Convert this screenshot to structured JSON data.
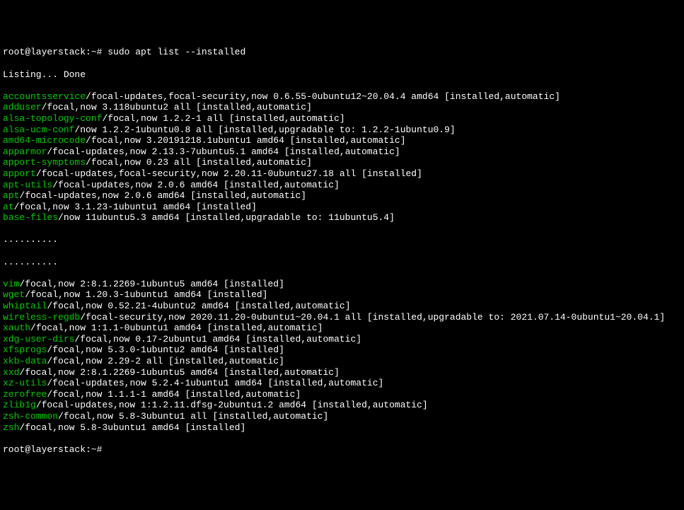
{
  "prompt1": {
    "user_host": "root@layerstack",
    "tilde": ":~",
    "hash": "# ",
    "command": "sudo apt list --installed"
  },
  "listing": "Listing... Done",
  "packages_top": [
    {
      "name": "accountsservice",
      "rest": "/focal-updates,focal-security,now 0.6.55-0ubuntu12~20.04.4 amd64 [installed,automatic]"
    },
    {
      "name": "adduser",
      "rest": "/focal,now 3.118ubuntu2 all [installed,automatic]"
    },
    {
      "name": "alsa-topology-conf",
      "rest": "/focal,now 1.2.2-1 all [installed,automatic]"
    },
    {
      "name": "alsa-ucm-conf",
      "rest": "/now 1.2.2-1ubuntu0.8 all [installed,upgradable to: 1.2.2-1ubuntu0.9]"
    },
    {
      "name": "amd64-microcode",
      "rest": "/focal,now 3.20191218.1ubuntu1 amd64 [installed,automatic]"
    },
    {
      "name": "apparmor",
      "rest": "/focal-updates,now 2.13.3-7ubuntu5.1 amd64 [installed,automatic]"
    },
    {
      "name": "apport-symptoms",
      "rest": "/focal,now 0.23 all [installed,automatic]"
    },
    {
      "name": "apport",
      "rest": "/focal-updates,focal-security,now 2.20.11-0ubuntu27.18 all [installed]"
    },
    {
      "name": "apt-utils",
      "rest": "/focal-updates,now 2.0.6 amd64 [installed,automatic]"
    },
    {
      "name": "apt",
      "rest": "/focal-updates,now 2.0.6 amd64 [installed,automatic]"
    },
    {
      "name": "at",
      "rest": "/focal,now 3.1.23-1ubuntu1 amd64 [installed]"
    },
    {
      "name": "base-files",
      "rest": "/now 11ubuntu5.3 amd64 [installed,upgradable to: 11ubuntu5.4]"
    }
  ],
  "ellipsis1": "..........",
  "ellipsis2": "..........",
  "packages_bottom": [
    {
      "name": "vim",
      "rest": "/focal,now 2:8.1.2269-1ubuntu5 amd64 [installed]"
    },
    {
      "name": "wget",
      "rest": "/focal,now 1.20.3-1ubuntu1 amd64 [installed]"
    },
    {
      "name": "whiptail",
      "rest": "/focal,now 0.52.21-4ubuntu2 amd64 [installed,automatic]"
    },
    {
      "name": "wireless-regdb",
      "rest": "/focal-security,now 2020.11.20-0ubuntu1~20.04.1 all [installed,upgradable to: 2021.07.14-0ubuntu1~20.04.1]"
    },
    {
      "name": "xauth",
      "rest": "/focal,now 1:1.1-0ubuntu1 amd64 [installed,automatic]"
    },
    {
      "name": "xdg-user-dirs",
      "rest": "/focal,now 0.17-2ubuntu1 amd64 [installed,automatic]"
    },
    {
      "name": "xfsprogs",
      "rest": "/focal,now 5.3.0-1ubuntu2 amd64 [installed]"
    },
    {
      "name": "xkb-data",
      "rest": "/focal,now 2.29-2 all [installed,automatic]"
    },
    {
      "name": "xxd",
      "rest": "/focal,now 2:8.1.2269-1ubuntu5 amd64 [installed,automatic]"
    },
    {
      "name": "xz-utils",
      "rest": "/focal-updates,now 5.2.4-1ubuntu1 amd64 [installed,automatic]"
    },
    {
      "name": "zerofree",
      "rest": "/focal,now 1.1.1-1 amd64 [installed,automatic]"
    },
    {
      "name": "zlib1g",
      "rest": "/focal-updates,now 1:1.2.11.dfsg-2ubuntu1.2 amd64 [installed,automatic]"
    },
    {
      "name": "zsh-common",
      "rest": "/focal,now 5.8-3ubuntu1 all [installed,automatic]"
    },
    {
      "name": "zsh",
      "rest": "/focal,now 5.8-3ubuntu1 amd64 [installed]"
    }
  ],
  "prompt2": {
    "user_host": "root@layerstack",
    "tilde": ":~",
    "hash": "#"
  }
}
